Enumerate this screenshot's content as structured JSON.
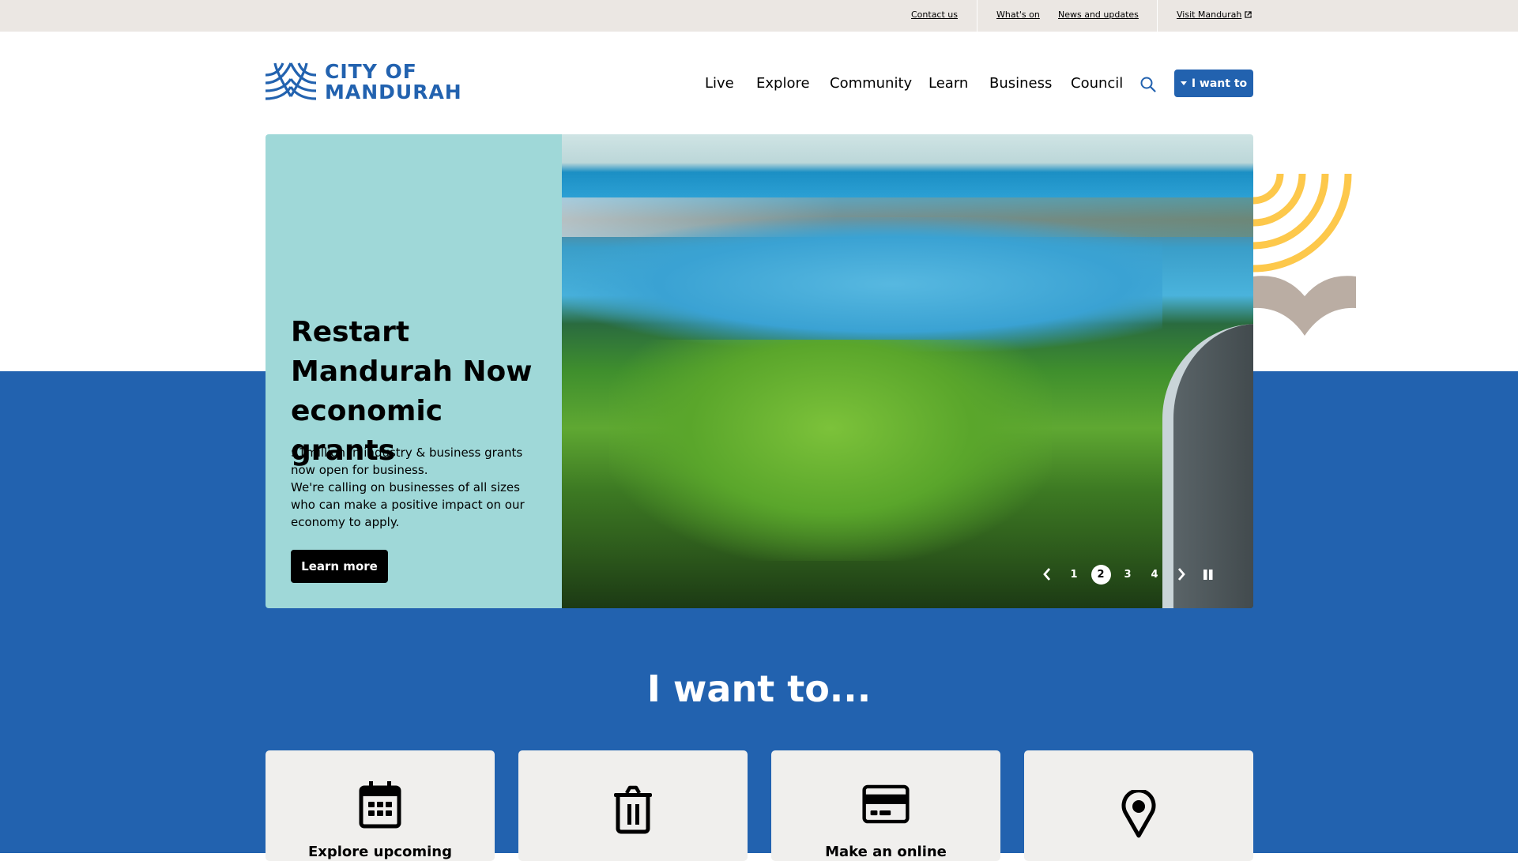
{
  "utility_nav": {
    "contact": "Contact us",
    "whats_on": "What's on",
    "news": "News and updates",
    "visit": "Visit Mandurah",
    "visit_icon": "external-link-icon"
  },
  "logo": {
    "line1": "CITY OF",
    "line2": "MANDURAH",
    "color": "#2262af"
  },
  "main_nav": {
    "items": [
      "Live",
      "Explore",
      "Community",
      "Learn",
      "Business",
      "Council"
    ],
    "search_icon": "search-icon",
    "i_want_to": "I want to"
  },
  "hero": {
    "title": "Restart Mandurah Now economic grants",
    "description_line1": "$1million in industry & business grants now open for business.",
    "description_line2": "We're calling on businesses of all sizes who can make a positive impact on our economy to apply.",
    "cta": "Learn more",
    "panel_color": "#9fd8d8",
    "image_alt": "Aerial view of Mandurah estuary, parkland and bridge",
    "carousel": {
      "slides": [
        "1",
        "2",
        "3",
        "4"
      ],
      "active": "2",
      "prev_icon": "chevron-left-icon",
      "next_icon": "chevron-right-icon",
      "pause_icon": "pause-icon"
    }
  },
  "i_want_to_section": {
    "heading": "I want to...",
    "background": "#2262af",
    "cards": [
      {
        "icon": "calendar-icon",
        "label": "Explore upcoming"
      },
      {
        "icon": "trash-icon",
        "label": ""
      },
      {
        "icon": "credit-card-icon",
        "label": "Make an online"
      },
      {
        "icon": "map-pin-icon",
        "label": ""
      }
    ]
  }
}
